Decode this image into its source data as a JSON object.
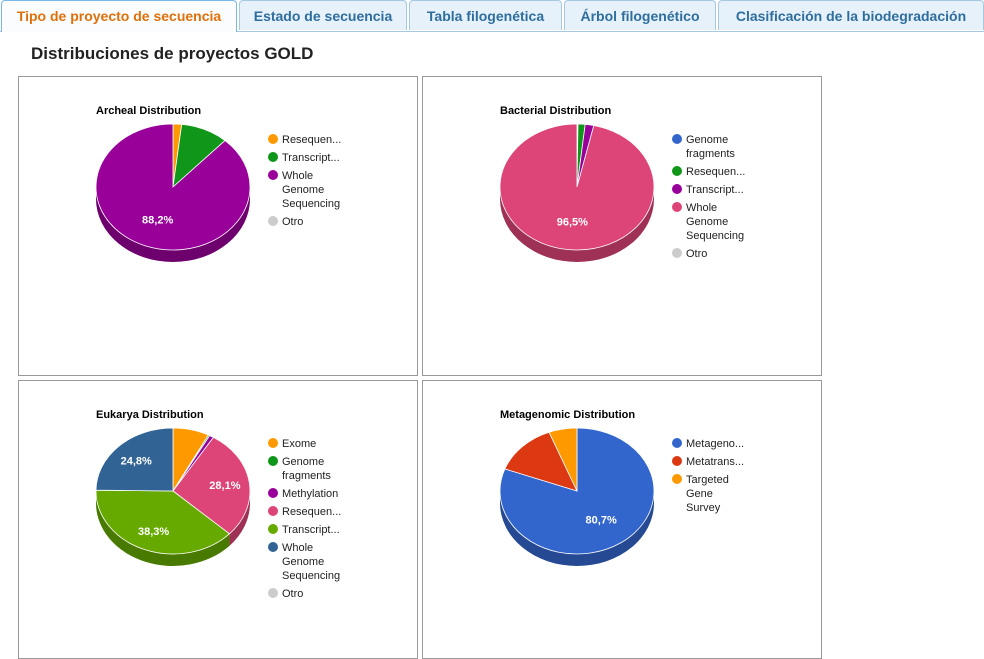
{
  "tabs": [
    {
      "label": "Tipo de proyecto de secuencia",
      "active": true
    },
    {
      "label": "Estado de secuencia",
      "active": false
    },
    {
      "label": "Tabla filogenética",
      "active": false
    },
    {
      "label": "Árbol filogenético",
      "active": false
    },
    {
      "label": "Clasificación de la biodegradación",
      "active": false
    }
  ],
  "page_title": "Distribuciones de proyectos GOLD",
  "chart_data": [
    {
      "type": "pie",
      "title": "Archeal Distribution",
      "legend_position": "right",
      "series": [
        {
          "name": "Resequencing",
          "legend_label": "Resequen...",
          "value": 1.8,
          "color": "#ff9900",
          "legend_lines": [
            "Resequen..."
          ]
        },
        {
          "name": "Transcriptome",
          "legend_label": "Transcript...",
          "value": 10.0,
          "color": "#109618",
          "legend_lines": [
            "Transcript..."
          ]
        },
        {
          "name": "Whole Genome Sequencing",
          "legend_label": "Whole Genome Sequencing",
          "value": 88.2,
          "color": "#990099",
          "legend_lines": [
            "Whole",
            "Genome",
            "Sequencing"
          ]
        },
        {
          "name": "Otro",
          "legend_label": "Otro",
          "value": 0,
          "color": "#cccccc",
          "legend_lines": [
            "Otro"
          ]
        }
      ],
      "slice_labels": [
        {
          "series": "Whole Genome Sequencing",
          "text": "88,2%"
        }
      ]
    },
    {
      "type": "pie",
      "title": "Bacterial Distribution",
      "legend_position": "right",
      "series": [
        {
          "name": "Genome fragments",
          "legend_label": "Genome fragments",
          "value": 0.2,
          "color": "#3366cc",
          "legend_lines": [
            "Genome",
            "fragments"
          ]
        },
        {
          "name": "Resequencing",
          "legend_label": "Resequen...",
          "value": 1.5,
          "color": "#109618",
          "legend_lines": [
            "Resequen..."
          ]
        },
        {
          "name": "Transcriptome",
          "legend_label": "Transcript...",
          "value": 1.8,
          "color": "#990099",
          "legend_lines": [
            "Transcript..."
          ]
        },
        {
          "name": "Whole Genome Sequencing",
          "legend_label": "Whole Genome Sequencing",
          "value": 96.5,
          "color": "#dd4477",
          "legend_lines": [
            "Whole",
            "Genome",
            "Sequencing"
          ]
        },
        {
          "name": "Otro",
          "legend_label": "Otro",
          "value": 0,
          "color": "#cccccc",
          "legend_lines": [
            "Otro"
          ]
        }
      ],
      "slice_labels": [
        {
          "series": "Whole Genome Sequencing",
          "text": "96,5%"
        }
      ]
    },
    {
      "type": "pie",
      "title": "Eukarya Distribution",
      "legend_position": "right",
      "series": [
        {
          "name": "Exome",
          "legend_label": "Exome",
          "value": 7.6,
          "color": "#ff9900",
          "legend_lines": [
            "Exome"
          ]
        },
        {
          "name": "Genome fragments",
          "legend_label": "Genome fragments",
          "value": 0.3,
          "color": "#109618",
          "legend_lines": [
            "Genome",
            "fragments"
          ]
        },
        {
          "name": "Methylation",
          "legend_label": "Methylation",
          "value": 0.9,
          "color": "#990099",
          "legend_lines": [
            "Methylation"
          ]
        },
        {
          "name": "Resequencing",
          "legend_label": "Resequen...",
          "value": 28.1,
          "color": "#dd4477",
          "legend_lines": [
            "Resequen..."
          ]
        },
        {
          "name": "Transcriptome",
          "legend_label": "Transcript...",
          "value": 38.3,
          "color": "#66aa00",
          "legend_lines": [
            "Transcript..."
          ]
        },
        {
          "name": "Whole Genome Sequencing",
          "legend_label": "Whole Genome Sequencing",
          "value": 24.8,
          "color": "#316395",
          "legend_lines": [
            "Whole",
            "Genome",
            "Sequencing"
          ]
        },
        {
          "name": "Otro",
          "legend_label": "Otro",
          "value": 0,
          "color": "#cccccc",
          "legend_lines": [
            "Otro"
          ]
        }
      ],
      "slice_labels": [
        {
          "series": "Resequencing",
          "text": "28,1%"
        },
        {
          "series": "Transcriptome",
          "text": "38,3%"
        },
        {
          "series": "Whole Genome Sequencing",
          "text": "24,8%"
        }
      ]
    },
    {
      "type": "pie",
      "title": "Metagenomic Distribution",
      "legend_position": "right",
      "series": [
        {
          "name": "Metagenome",
          "legend_label": "Metageno...",
          "value": 80.7,
          "color": "#3366cc",
          "legend_lines": [
            "Metageno..."
          ]
        },
        {
          "name": "Metatranscriptome",
          "legend_label": "Metatrans...",
          "value": 13.4,
          "color": "#dc3912",
          "legend_lines": [
            "Metatrans..."
          ]
        },
        {
          "name": "Targeted Gene Survey",
          "legend_label": "Targeted Gene Survey",
          "value": 5.9,
          "color": "#ff9900",
          "legend_lines": [
            "Targeted",
            "Gene",
            "Survey"
          ]
        }
      ],
      "slice_labels": [
        {
          "series": "Metagenome",
          "text": "80,7%"
        }
      ]
    }
  ]
}
